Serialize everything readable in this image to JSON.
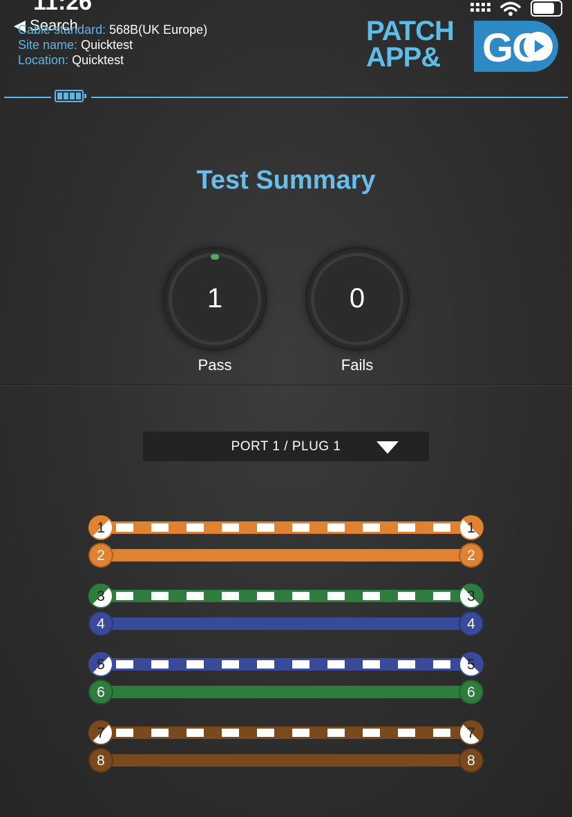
{
  "status_bar": {
    "time": "11:26",
    "back_label": "◀ Search"
  },
  "info": {
    "cable_standard_label": "Cable standard:",
    "cable_standard": "568B(UK Europe)",
    "site_name_label": "Site name:",
    "site_name": "Quicktest",
    "location_label": "Location:",
    "location": "Quicktest"
  },
  "logo": {
    "line1": "PATCH",
    "line2": "APP&",
    "go": "GO"
  },
  "summary": {
    "title": "Test Summary",
    "pass_count": "1",
    "pass_label": "Pass",
    "fail_count": "0",
    "fail_label": "Fails"
  },
  "port_select": {
    "value": "PORT 1 / PLUG 1"
  },
  "wires": [
    {
      "pin": "1",
      "color": "#e0822f",
      "striped": true
    },
    {
      "pin": "2",
      "color": "#e0822f",
      "striped": false
    },
    {
      "pin": "3",
      "color": "#2f7d3e",
      "striped": true
    },
    {
      "pin": "4",
      "color": "#3a4a9a",
      "striped": false
    },
    {
      "pin": "5",
      "color": "#3a4a9a",
      "striped": true
    },
    {
      "pin": "6",
      "color": "#2f7d3e",
      "striped": false
    },
    {
      "pin": "7",
      "color": "#7a4a1c",
      "striped": true
    },
    {
      "pin": "8",
      "color": "#7a4a1c",
      "striped": false
    }
  ],
  "colors": {
    "accent": "#5fb6e8",
    "pass_indicator": "#4cae5a"
  }
}
